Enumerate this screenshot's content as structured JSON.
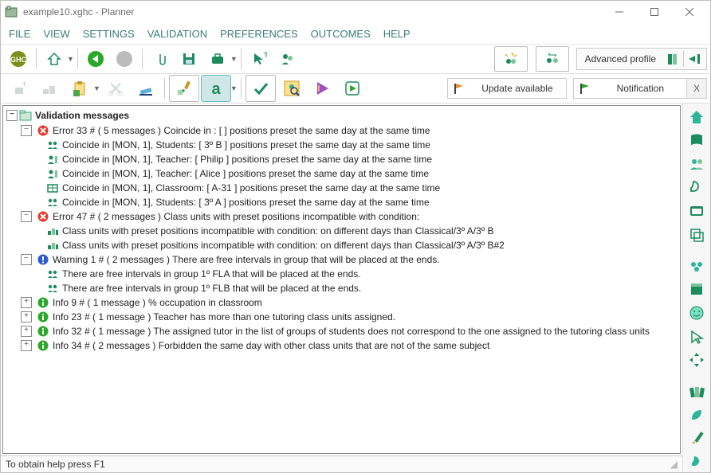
{
  "title": "example10.xghc - Planner",
  "menu": [
    "FILE",
    "VIEW",
    "SETTINGS",
    "VALIDATION",
    "PREFERENCES",
    "OUTCOMES",
    "HELP"
  ],
  "advanced_label": "Advanced profile",
  "update_label": "Update available",
  "notification_label": "Notification",
  "notification_close": "X",
  "tree_header": "Validation messages",
  "nodes": [
    {
      "level": 1,
      "exp": "-",
      "icon": "error",
      "text": "Error 33 # ( 5 messages ) Coincide in : [  ] positions preset the same day at the same time"
    },
    {
      "level": 2,
      "icon": "students",
      "text": "Coincide in [MON, 1], Students: [ 3º B ] positions preset the same day at the same time"
    },
    {
      "level": 2,
      "icon": "teacher",
      "text": "Coincide in [MON, 1], Teacher: [ Philip ] positions preset the same day at the same time"
    },
    {
      "level": 2,
      "icon": "teacher",
      "text": "Coincide in [MON, 1], Teacher: [ Alice ] positions preset the same day at the same time"
    },
    {
      "level": 2,
      "icon": "class",
      "text": "Coincide in [MON, 1], Classroom: [ A-31 ] positions preset the same day at the same time"
    },
    {
      "level": 2,
      "icon": "students",
      "text": "Coincide in [MON, 1], Students: [ 3º A ] positions preset the same day at the same time"
    },
    {
      "level": 1,
      "exp": "-",
      "icon": "error",
      "text": "Error 47 # ( 2 messages ) Class units with preset positions incompatible with condition:"
    },
    {
      "level": 2,
      "icon": "units",
      "text": "Class units with preset positions incompatible with condition: on different days than Classical/3º A/3º B"
    },
    {
      "level": 2,
      "icon": "units",
      "text": "Class units with preset positions incompatible with condition: on different days than Classical/3º A/3º B#2"
    },
    {
      "level": 1,
      "exp": "-",
      "icon": "warn",
      "text": "Warning 1 # ( 2 messages ) There are free intervals in group  that will be placed at the ends."
    },
    {
      "level": 2,
      "icon": "students",
      "text": "There are free intervals in group 1º FLA that will be placed at the ends."
    },
    {
      "level": 2,
      "icon": "students",
      "text": "There are free intervals in group 1º FLB that will be placed at the ends."
    },
    {
      "level": 1,
      "exp": "+",
      "icon": "info",
      "text": "Info 9 # ( 1 message )  % occupation in classroom"
    },
    {
      "level": 1,
      "exp": "+",
      "icon": "info",
      "text": "Info 23 # ( 1 message )  Teacher  has more than one tutoring class units assigned."
    },
    {
      "level": 1,
      "exp": "+",
      "icon": "info",
      "text": "Info 32 # ( 1 message )  The assigned tutor in the list of groups of students  does not correspond to the one assigned to the tutoring class units"
    },
    {
      "level": 1,
      "exp": "+",
      "icon": "info",
      "text": "Info 34 # ( 2 messages ) Forbidden the same day with other class units that are not of the same subject"
    }
  ],
  "status": "To obtain help press F1"
}
